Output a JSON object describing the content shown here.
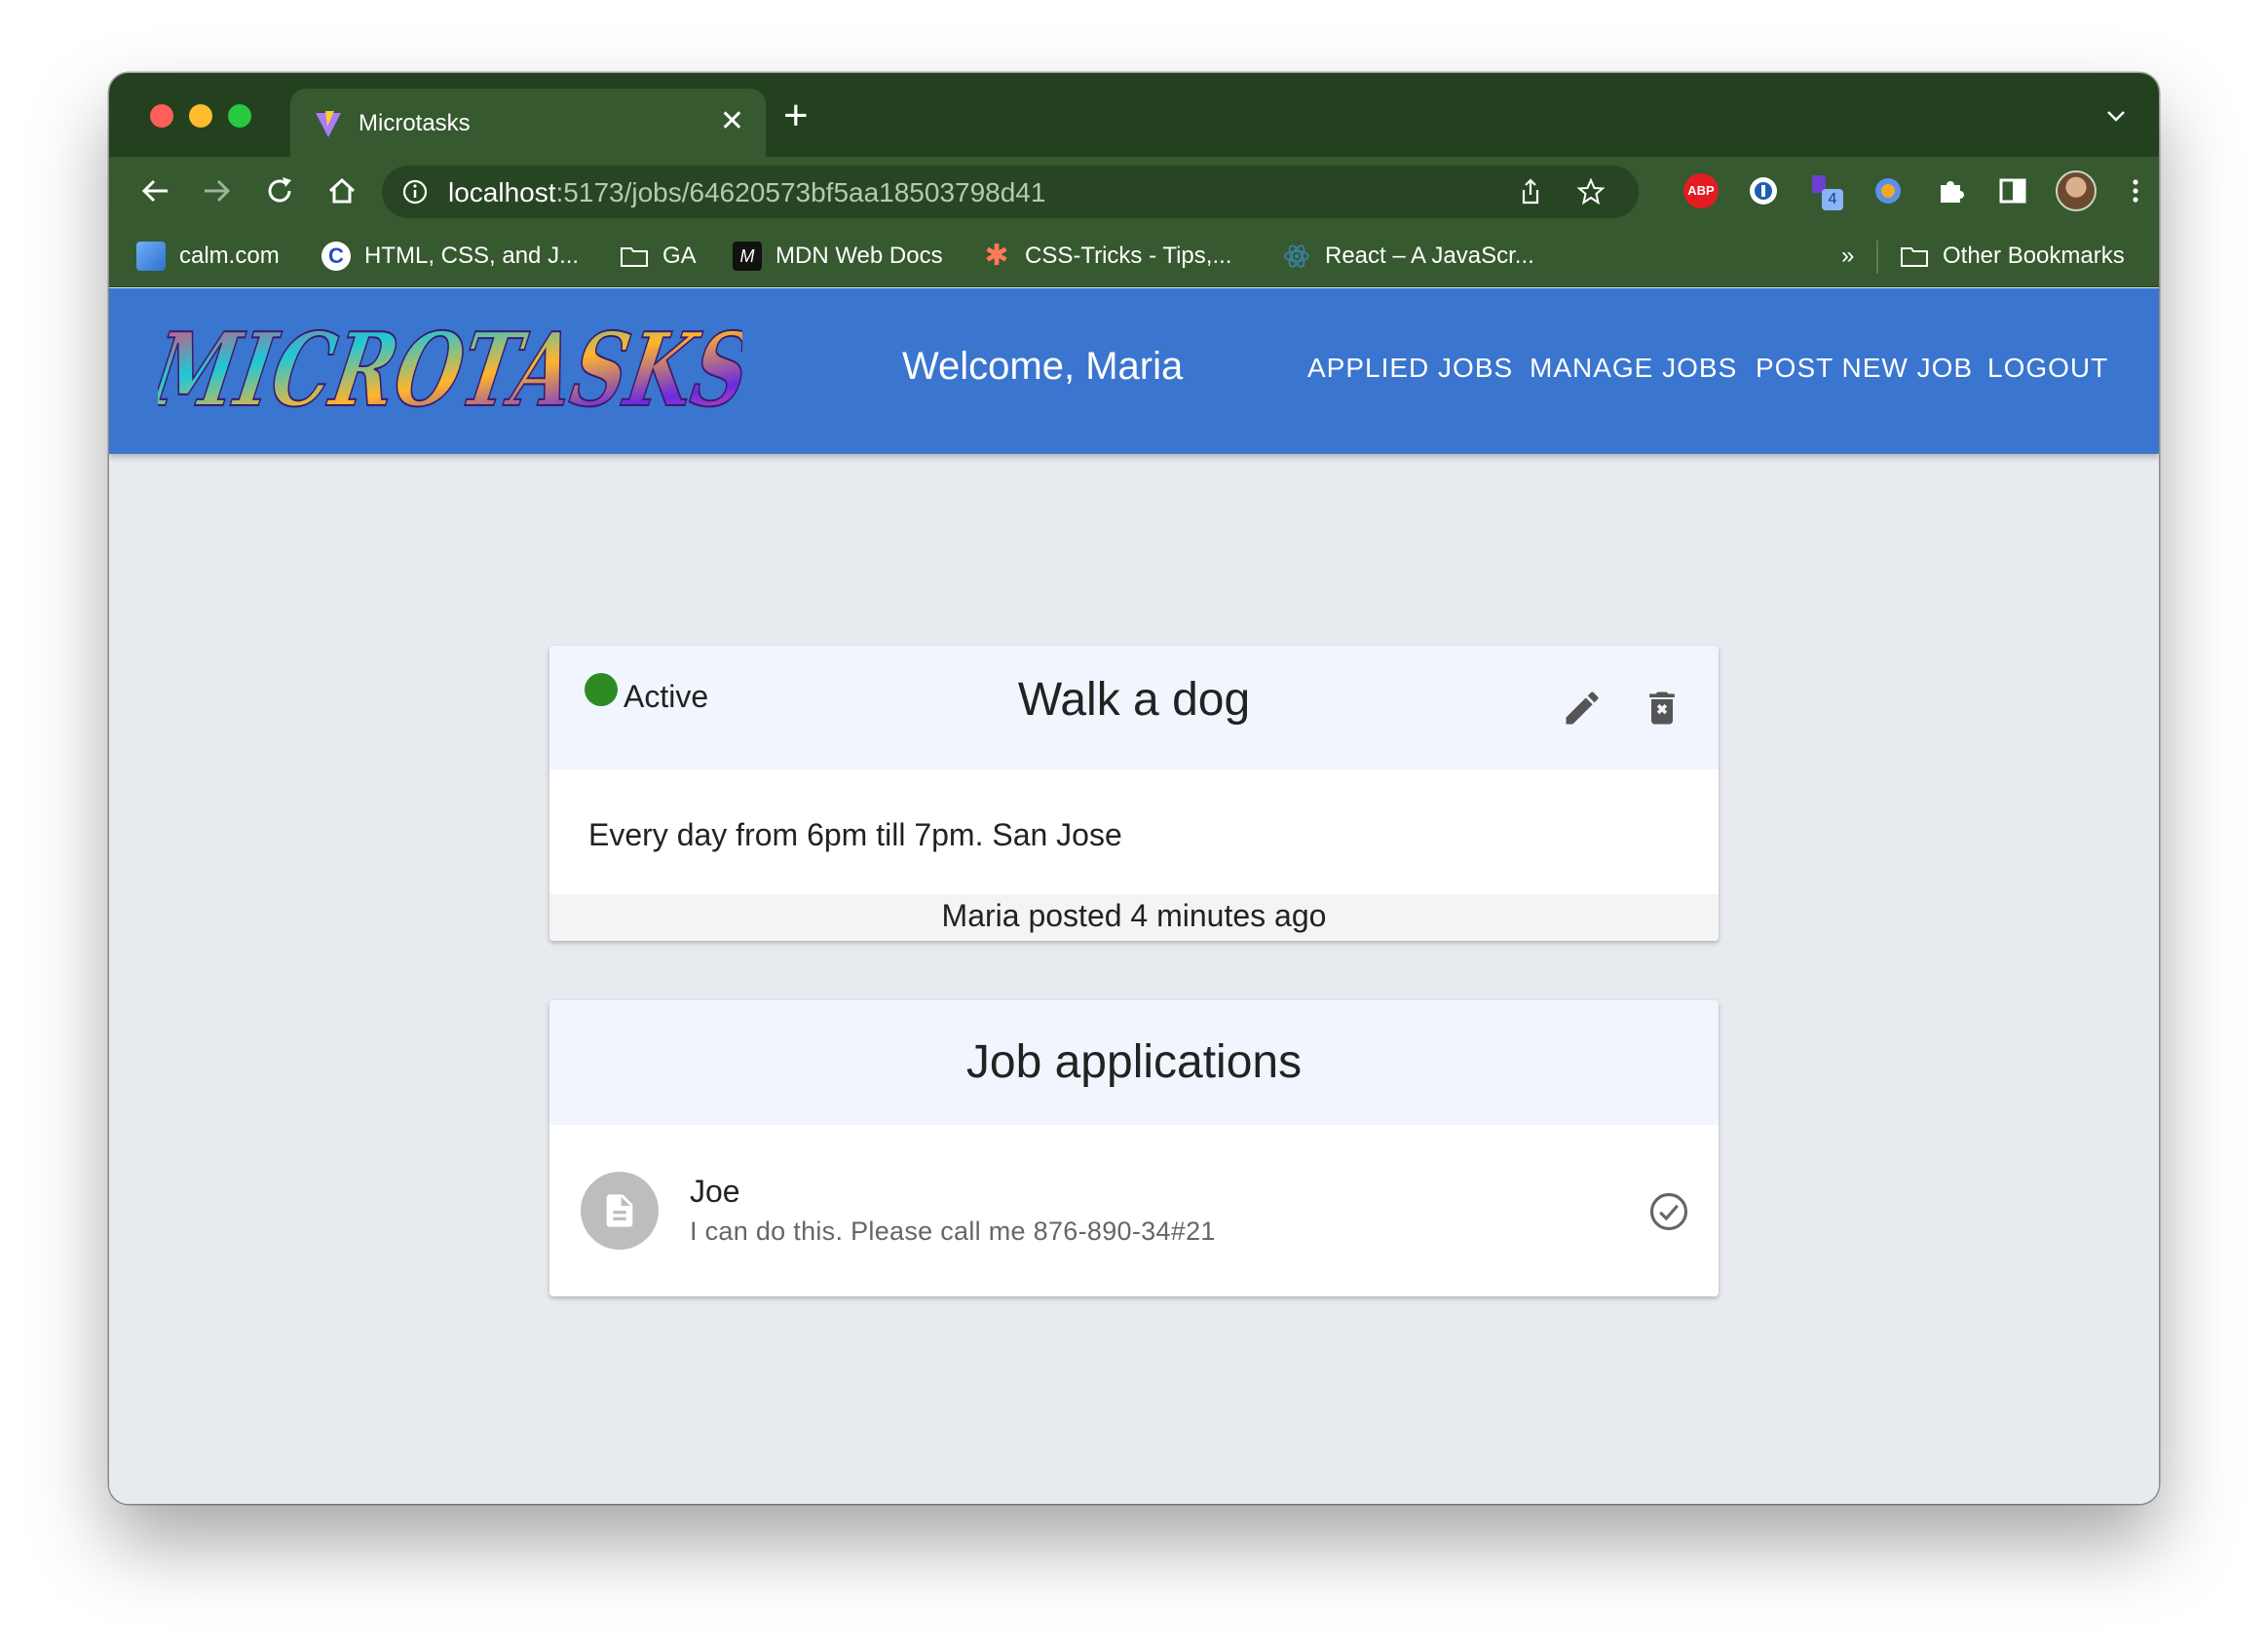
{
  "browser": {
    "tab_title": "Microtasks",
    "url_host": "localhost",
    "url_path": ":5173/jobs/64620573bf5aa18503798d41",
    "bookmarks": [
      {
        "label": "calm.com"
      },
      {
        "label": "HTML, CSS, and J..."
      },
      {
        "label": "GA"
      },
      {
        "label": "MDN Web Docs"
      },
      {
        "label": "CSS-Tricks - Tips,..."
      },
      {
        "label": "React – A JavaScr..."
      }
    ],
    "bookmarks_overflow": "»",
    "other_bookmarks": "Other Bookmarks",
    "extension_abp": "ABP",
    "extension_badge": "4"
  },
  "app": {
    "logo_text": "MICROTASKS",
    "welcome": "Welcome, Maria",
    "nav": {
      "applied_jobs": "APPLIED JOBS",
      "manage_jobs": "MANAGE JOBS",
      "post_new_job": "POST NEW JOB",
      "logout": "LOGOUT"
    }
  },
  "job": {
    "status": "Active",
    "status_color": "#2e8b24",
    "title": "Walk a dog",
    "description": "Every day from 6pm till 7pm. San Jose",
    "posted": "Maria posted 4 minutes ago"
  },
  "applications": {
    "title": "Job applications",
    "items": [
      {
        "name": "Joe",
        "message": "I can do this. Please call me 876-890-34#21"
      }
    ]
  },
  "colors": {
    "appbar": "#3a75cf",
    "browser_frame": "#36592f",
    "page_bg": "#e7eaee"
  }
}
